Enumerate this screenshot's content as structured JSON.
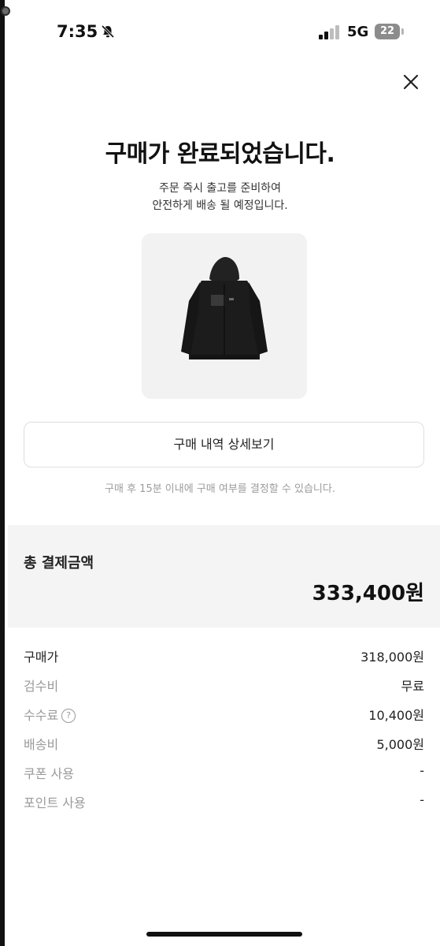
{
  "status_bar": {
    "time": "7:35",
    "network": "5G",
    "battery": "22",
    "icons": [
      "bell-muted-icon",
      "signal-icon"
    ]
  },
  "header": {
    "close_icon": "close-icon"
  },
  "confirmation": {
    "title": "구매가 완료되었습니다.",
    "subtitle_line1": "주문 즉시 출고를 준비하여",
    "subtitle_line2": "안전하게 배송 될 예정입니다."
  },
  "product": {
    "image": "black-hooded-jacket"
  },
  "actions": {
    "detail_button": "구매 내역 상세보기",
    "notice": "구매 후 15분 이내에 구매 여부를 결정할 수 있습니다."
  },
  "total": {
    "label": "총 결제금액",
    "value": "333,400원"
  },
  "breakdown": [
    {
      "label": "구매가",
      "value": "318,000원"
    },
    {
      "label": "검수비",
      "value": "무료"
    },
    {
      "label": "수수료",
      "value": "10,400원",
      "help_icon": "?"
    },
    {
      "label": "배송비",
      "value": "5,000원"
    },
    {
      "label": "쿠폰 사용",
      "value": "-"
    },
    {
      "label": "포인트 사용",
      "value": "-"
    }
  ],
  "colors": {
    "background": "#ffffff",
    "total_panel": "#f4f4f4",
    "muted_text": "#9a9a9a",
    "primary_text": "#111111"
  }
}
